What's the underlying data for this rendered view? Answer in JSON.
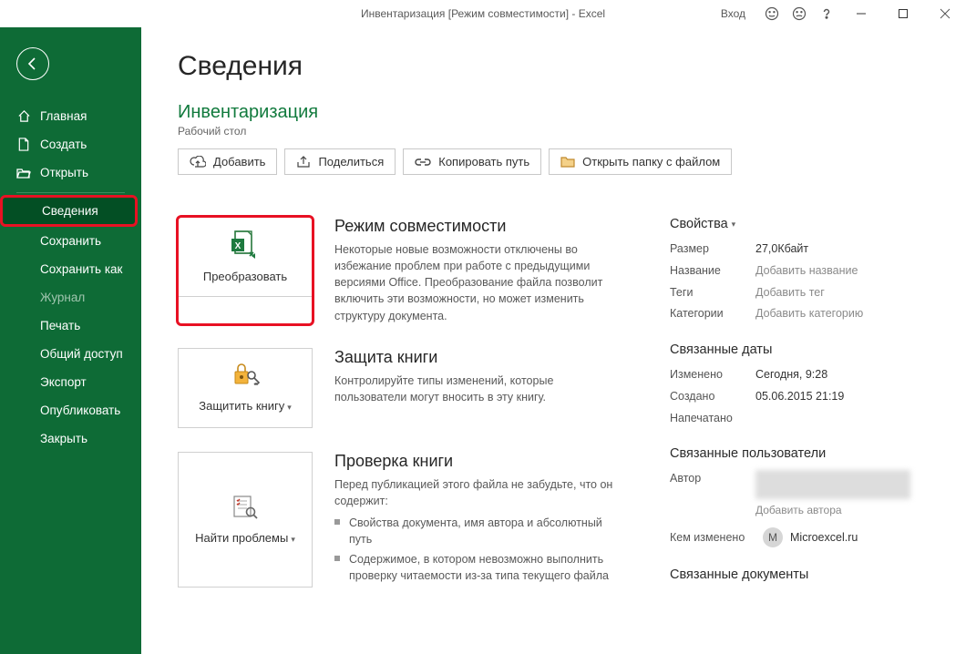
{
  "titlebar": {
    "full_title": "Инвентаризация  [Режим совместимости]  -  Excel",
    "login": "Вход"
  },
  "sidebar": {
    "items": [
      {
        "label": "Главная"
      },
      {
        "label": "Создать"
      },
      {
        "label": "Открыть"
      },
      {
        "label": "Сведения"
      },
      {
        "label": "Сохранить"
      },
      {
        "label": "Сохранить как"
      },
      {
        "label": "Журнал"
      },
      {
        "label": "Печать"
      },
      {
        "label": "Общий доступ"
      },
      {
        "label": "Экспорт"
      },
      {
        "label": "Опубликовать"
      },
      {
        "label": "Закрыть"
      }
    ]
  },
  "main": {
    "heading": "Сведения",
    "doc_name": "Инвентаризация",
    "doc_location": "Рабочий стол",
    "actions": {
      "add": "Добавить",
      "share": "Поделиться",
      "copy_path": "Копировать путь",
      "open_folder": "Открыть папку с файлом"
    },
    "sections": {
      "compat": {
        "card": "Преобразовать",
        "title": "Режим совместимости",
        "desc": "Некоторые новые возможности отключены во избежание проблем при работе с предыдущими версиями Office. Преобразование файла позволит включить эти возможности, но может изменить структуру документа."
      },
      "protect": {
        "card": "Защитить книгу",
        "title": "Защита книги",
        "desc": "Контролируйте типы изменений, которые пользователи могут вносить в эту книгу."
      },
      "inspect": {
        "card": "Найти проблемы",
        "title": "Проверка книги",
        "desc": "Перед публикацией этого файла не забудьте, что он содержит:",
        "bullets": [
          "Свойства документа, имя автора и абсолютный путь",
          "Содержимое, в котором невозможно выполнить проверку читаемости из-за типа текущего файла"
        ]
      }
    }
  },
  "props": {
    "heading": "Свойства",
    "size_label": "Размер",
    "size_val": "27,0Кбайт",
    "name_label": "Название",
    "name_hint": "Добавить название",
    "tags_label": "Теги",
    "tags_hint": "Добавить тег",
    "cat_label": "Категории",
    "cat_hint": "Добавить категорию",
    "dates_heading": "Связанные даты",
    "mod_label": "Изменено",
    "mod_val": "Сегодня, 9:28",
    "created_label": "Создано",
    "created_val": "05.06.2015 21:19",
    "printed_label": "Напечатано",
    "users_heading": "Связанные пользователи",
    "author_label": "Автор",
    "add_author": "Добавить автора",
    "modby_label": "Кем изменено",
    "modby_initial": "M",
    "modby_name": "Microexcel.ru",
    "docs_heading": "Связанные документы"
  }
}
